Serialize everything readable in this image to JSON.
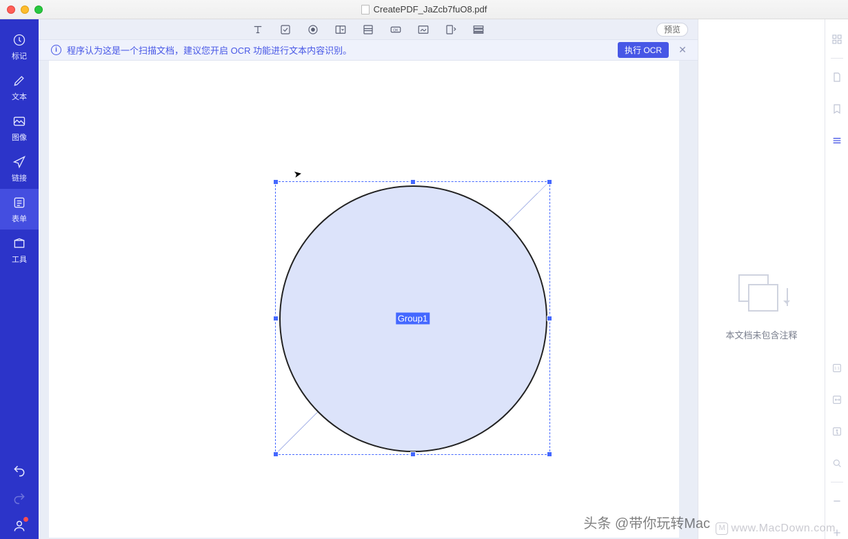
{
  "titlebar": {
    "filename": "CreatePDF_JaZcb7fuO8.pdf"
  },
  "sidebar": {
    "items": [
      {
        "id": "mark",
        "label": "标记"
      },
      {
        "id": "text",
        "label": "文本"
      },
      {
        "id": "image",
        "label": "图像"
      },
      {
        "id": "link",
        "label": "链接"
      },
      {
        "id": "form",
        "label": "表单"
      },
      {
        "id": "tools",
        "label": "工具"
      }
    ]
  },
  "toolbar": {
    "preview_label": "预览"
  },
  "banner": {
    "message": "程序认为这是一个扫描文档，建议您开启 OCR 功能进行文本内容识别。",
    "ocr_button": "执行 OCR"
  },
  "canvas": {
    "group_label": "Group1"
  },
  "inspector": {
    "empty_text": "本文档未包含注释"
  },
  "watermarks": {
    "left": "头条 @带你玩转Mac",
    "right": "www.MacDown.com"
  }
}
